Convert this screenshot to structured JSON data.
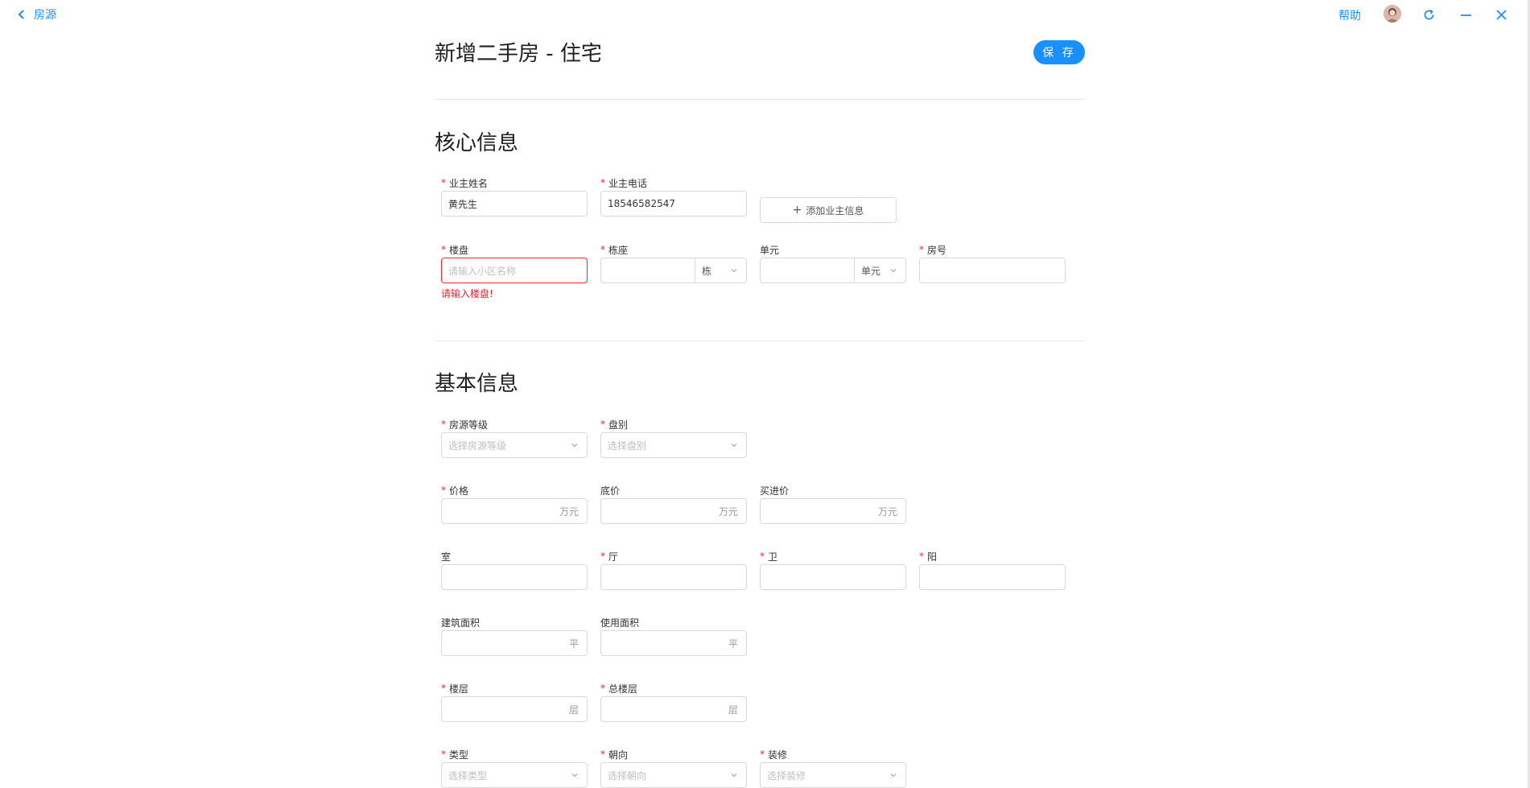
{
  "header": {
    "back_label": "房源",
    "help_label": "帮助"
  },
  "page": {
    "title": "新增二手房 - 住宅",
    "save_label": "保 存"
  },
  "core": {
    "title": "核心信息",
    "owner_name_label": "业主姓名",
    "owner_name_value": "黄先生",
    "owner_phone_label": "业主电话",
    "owner_phone_value": "18546582547",
    "add_owner_label": "添加业主信息",
    "estate_label": "楼盘",
    "estate_placeholder": "请输入小区名称",
    "estate_error": "请输入楼盘!",
    "building_label": "栋座",
    "building_unit": "栋",
    "unit_label": "单元",
    "unit_unit": "单元",
    "room_label": "房号"
  },
  "basic": {
    "title": "基本信息",
    "grade_label": "房源等级",
    "grade_placeholder": "选择房源等级",
    "disk_label": "盘别",
    "disk_placeholder": "选择盘别",
    "price_label": "价格",
    "price_suffix": "万元",
    "floor_price_label": "底价",
    "floor_price_suffix": "万元",
    "buy_price_label": "买进价",
    "buy_price_suffix": "万元",
    "room_count_label": "室",
    "hall_label": "厅",
    "bath_label": "卫",
    "balcony_label": "阳",
    "build_area_label": "建筑面积",
    "build_area_suffix": "平",
    "use_area_label": "使用面积",
    "use_area_suffix": "平",
    "floor_label": "楼层",
    "floor_suffix": "层",
    "total_floor_label": "总楼层",
    "total_floor_suffix": "层",
    "type_label": "类型",
    "type_placeholder": "选择类型",
    "orientation_label": "朝向",
    "orientation_placeholder": "选择朝向",
    "decoration_label": "装修",
    "decoration_placeholder": "选择装修"
  },
  "colors": {
    "accent": "#1890ff",
    "error": "#f5222d",
    "border": "#d9d9d9"
  }
}
